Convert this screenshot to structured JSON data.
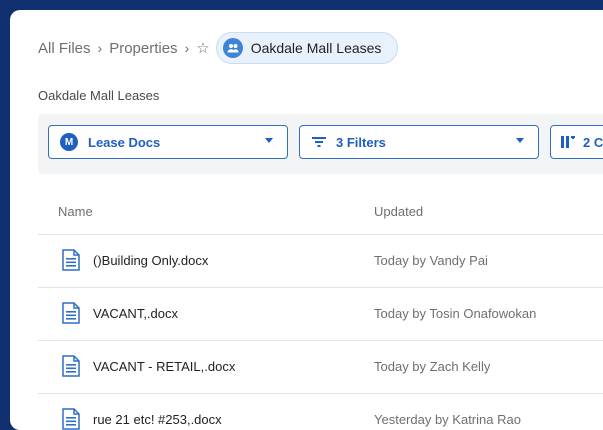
{
  "breadcrumb": {
    "items": [
      "All Files",
      "Properties"
    ],
    "current": "Oakdale Mall Leases"
  },
  "folder": {
    "title": "Oakdale Mall Leases"
  },
  "filters": {
    "metadata": {
      "badge": "M",
      "label": "Lease Docs"
    },
    "filters": {
      "label": "3 Filters"
    },
    "columns": {
      "label": "2 C"
    }
  },
  "table": {
    "headers": {
      "name": "Name",
      "updated": "Updated"
    },
    "rows": [
      {
        "name": "()Building Only.docx",
        "updated": "Today by Vandy Pai"
      },
      {
        "name": "VACANT,.docx",
        "updated": "Today by Tosin Onafowokan"
      },
      {
        "name": "VACANT - RETAIL,.docx",
        "updated": "Today by Zach Kelly"
      },
      {
        "name": "rue 21 etc! #253,.docx",
        "updated": "Yesterday by Katrina Rao"
      }
    ]
  },
  "colors": {
    "accent": "#2f6fc5",
    "background": "#0f2f6e",
    "chip": "#e9f2fc"
  },
  "icons": [
    "chevron-right-icon",
    "star-icon",
    "collab-folder-icon",
    "filter-icon",
    "columns-icon",
    "document-icon"
  ]
}
